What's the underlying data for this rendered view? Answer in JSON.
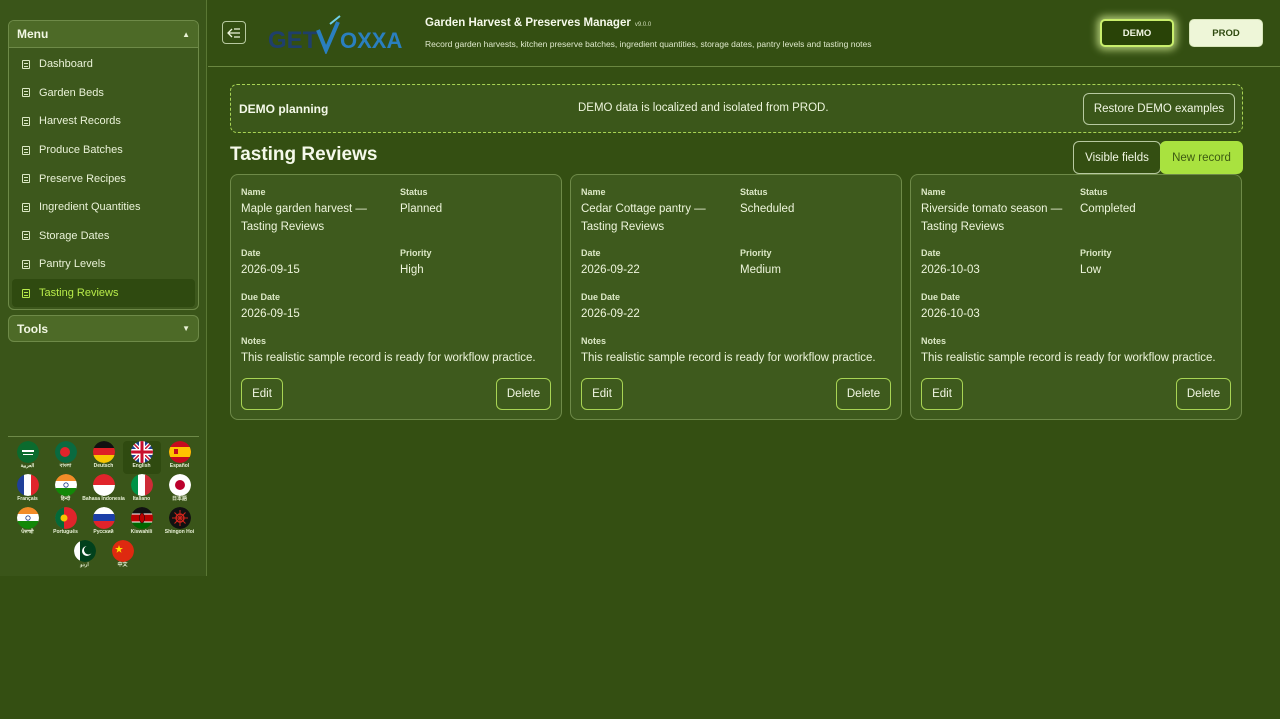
{
  "sidebar": {
    "menu_title": "Menu",
    "items": [
      {
        "label": "Dashboard"
      },
      {
        "label": "Garden Beds"
      },
      {
        "label": "Harvest Records"
      },
      {
        "label": "Produce Batches"
      },
      {
        "label": "Preserve Recipes"
      },
      {
        "label": "Ingredient Quantities"
      },
      {
        "label": "Storage Dates"
      },
      {
        "label": "Pantry Levels"
      },
      {
        "label": "Tasting Reviews",
        "active": true
      }
    ],
    "tools_title": "Tools",
    "languages": [
      {
        "label": "العربية",
        "icon": "flag-saudi-arabia-icon"
      },
      {
        "label": "বাংলা",
        "icon": "flag-bangladesh-icon"
      },
      {
        "label": "Deutsch",
        "icon": "flag-germany-icon"
      },
      {
        "label": "English",
        "icon": "flag-uk-icon",
        "selected": true
      },
      {
        "label": "Español",
        "icon": "flag-spain-icon"
      },
      {
        "label": "Français",
        "icon": "flag-france-icon"
      },
      {
        "label": "हिन्दी",
        "icon": "flag-india-icon"
      },
      {
        "label": "Bahasa Indonesia",
        "icon": "flag-indonesia-icon"
      },
      {
        "label": "Italiano",
        "icon": "flag-italy-icon"
      },
      {
        "label": "日本語",
        "icon": "flag-japan-icon"
      },
      {
        "label": "ਪੰਜਾਬੀ",
        "icon": "flag-india-icon"
      },
      {
        "label": "Português",
        "icon": "flag-portugal-icon"
      },
      {
        "label": "Русский",
        "icon": "flag-russia-icon"
      },
      {
        "label": "Kiswahili",
        "icon": "flag-kenya-icon"
      },
      {
        "label": "Shingon Hoi",
        "icon": "emblem-icon"
      },
      {
        "label": "اردو",
        "icon": "flag-pakistan-icon"
      },
      {
        "label": "中文",
        "icon": "flag-china-icon"
      }
    ]
  },
  "header": {
    "logo_text": "GETVOXXA",
    "title": "Garden Harvest & Preserves Manager",
    "version": "v9.0.0",
    "subtitle": "Record garden harvests, kitchen preserve batches, ingredient quantities, storage dates, pantry levels and tasting notes",
    "env_demo": "DEMO",
    "env_prod": "PROD",
    "active_env": "DEMO"
  },
  "banner": {
    "title": "DEMO planning",
    "message": "DEMO data is localized and isolated from PROD.",
    "restore_label": "Restore DEMO examples"
  },
  "page": {
    "title": "Tasting Reviews",
    "visible_fields_label": "Visible fields",
    "new_record_label": "New record"
  },
  "field_labels": {
    "name": "Name",
    "status": "Status",
    "date": "Date",
    "priority": "Priority",
    "due_date": "Due Date",
    "notes": "Notes",
    "edit": "Edit",
    "delete": "Delete"
  },
  "records": [
    {
      "name_line1": "Maple garden harvest —",
      "name_line2": "Tasting Reviews",
      "status": "Planned",
      "date": "2026-09-15",
      "priority": "High",
      "due_date": "2026-09-15",
      "notes": "This realistic sample record is ready for workflow practice."
    },
    {
      "name_line1": "Cedar Cottage pantry —",
      "name_line2": "Tasting Reviews",
      "status": "Scheduled",
      "date": "2026-09-22",
      "priority": "Medium",
      "due_date": "2026-09-22",
      "notes": "This realistic sample record is ready for workflow practice."
    },
    {
      "name_line1": "Riverside tomato season —",
      "name_line2": "Tasting Reviews",
      "status": "Completed",
      "date": "2026-10-03",
      "priority": "Low",
      "due_date": "2026-10-03",
      "notes": "This realistic sample record is ready for workflow practice."
    }
  ],
  "colors": {
    "background": "#344f12",
    "accent": "#a9e23f",
    "active_menu_text": "#b8ec4a"
  }
}
